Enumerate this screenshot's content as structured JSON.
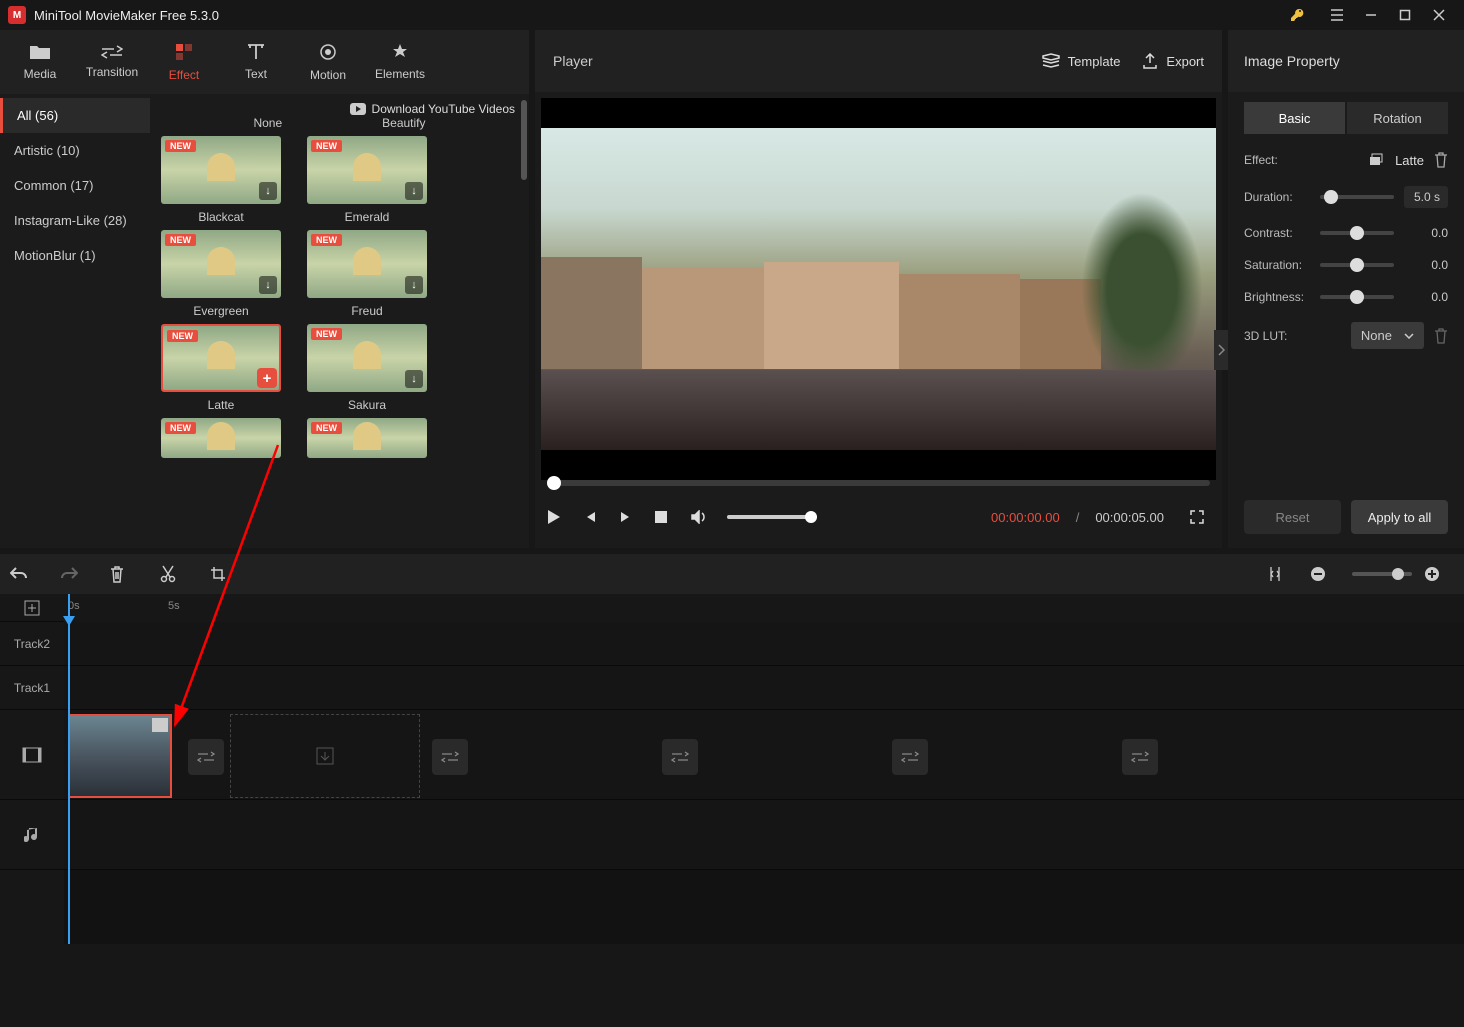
{
  "app": {
    "title": "MiniTool MovieMaker Free 5.3.0"
  },
  "tool_tabs": [
    {
      "label": "Media",
      "icon": "folder-icon"
    },
    {
      "label": "Transition",
      "icon": "transition-icon"
    },
    {
      "label": "Effect",
      "icon": "effect-icon",
      "active": true
    },
    {
      "label": "Text",
      "icon": "text-icon"
    },
    {
      "label": "Motion",
      "icon": "motion-icon"
    },
    {
      "label": "Elements",
      "icon": "elements-icon"
    }
  ],
  "categories": [
    {
      "label": "All (56)",
      "active": true
    },
    {
      "label": "Artistic (10)"
    },
    {
      "label": "Common (17)"
    },
    {
      "label": "Instagram-Like (28)"
    },
    {
      "label": "MotionBlur (1)"
    }
  ],
  "download_yt": "Download YouTube Videos",
  "effects": {
    "row0": [
      {
        "name": "None"
      },
      {
        "name": "Beautify"
      }
    ],
    "row1": [
      {
        "name": "Blackcat",
        "new": true
      },
      {
        "name": "Emerald",
        "new": true
      }
    ],
    "row2": [
      {
        "name": "Evergreen",
        "new": true
      },
      {
        "name": "Freud",
        "new": true
      }
    ],
    "row3": [
      {
        "name": "Latte",
        "new": true,
        "selected": true
      },
      {
        "name": "Sakura",
        "new": true
      }
    ],
    "row4": [
      {
        "name": "",
        "new": true
      },
      {
        "name": "",
        "new": true
      }
    ]
  },
  "player": {
    "title": "Player",
    "template_btn": "Template",
    "export_btn": "Export",
    "time_current": "00:00:00.00",
    "time_separator": "/",
    "time_total": "00:00:05.00"
  },
  "property": {
    "title": "Image Property",
    "tabs": {
      "basic": "Basic",
      "rotation": "Rotation"
    },
    "effect_label": "Effect:",
    "effect_value": "Latte",
    "duration_label": "Duration:",
    "duration_value": "5.0 s",
    "contrast_label": "Contrast:",
    "contrast_value": "0.0",
    "saturation_label": "Saturation:",
    "saturation_value": "0.0",
    "brightness_label": "Brightness:",
    "brightness_value": "0.0",
    "lut_label": "3D LUT:",
    "lut_value": "None",
    "reset": "Reset",
    "apply_all": "Apply to all"
  },
  "timeline": {
    "marks": {
      "m0": "0s",
      "m5": "5s"
    },
    "tracks": {
      "t2": "Track2",
      "t1": "Track1"
    }
  }
}
